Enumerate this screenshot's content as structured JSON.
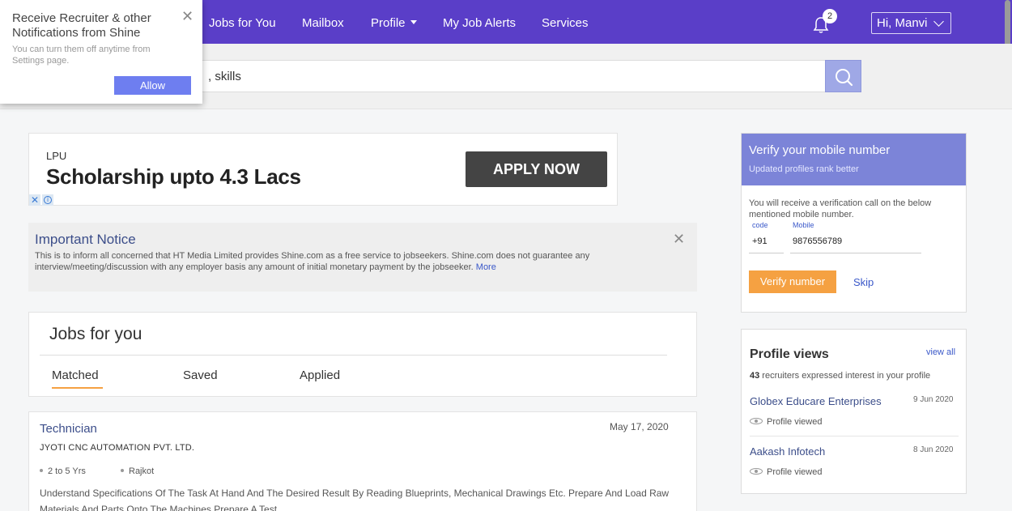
{
  "nav": {
    "items": [
      "Jobs for You",
      "Mailbox",
      "Profile",
      "My Job Alerts",
      "Services"
    ],
    "notification_count": "2",
    "user_greeting": "Hi,  Manvi"
  },
  "search": {
    "value": ", skills"
  },
  "popup": {
    "title": "Receive Recruiter & other Notifications from Shine",
    "body": "You can turn them off anytime from Settings page.",
    "allow_label": "Allow"
  },
  "ad": {
    "small": "LPU",
    "headline": "Scholarship upto 4.3 Lacs",
    "button_label": "APPLY NOW"
  },
  "notice": {
    "title": "Important Notice",
    "body": "This is to inform all concerned that HT Media Limited provides Shine.com as a free service to jobseekers. Shine.com does not guarantee any interview/meeting/discussion with any employer basis any amount of initial monetary payment by the jobseeker.",
    "more_label": "More"
  },
  "jobs_section": {
    "title": "Jobs for you",
    "tabs": [
      "Matched",
      "Saved",
      "Applied"
    ],
    "active_tab": "Matched"
  },
  "job": {
    "title": "Technician",
    "date": "May 17, 2020",
    "company": "JYOTI CNC AUTOMATION PVT. LTD.",
    "experience": "2 to 5 Yrs",
    "location": "Rajkot",
    "description": "Understand Specifications Of The Task At Hand And The Desired Result By Reading Blueprints, Mechanical Drawings Etc. Prepare And Load Raw Materials And Parts Onto The Machines Prepare A Test"
  },
  "verify": {
    "title": "Verify your mobile number",
    "subtitle": "Updated profiles rank better",
    "text": "You will receive a verification call on the below mentioned mobile number.",
    "code_label": "code",
    "code_value": "+91",
    "mobile_label": "Mobile",
    "mobile_value": "9876556789",
    "verify_label": "Verify number",
    "skip_label": "Skip"
  },
  "profile_views": {
    "title": "Profile views",
    "view_all": "view all",
    "count": "43",
    "subtitle_rest": " recruiters expressed interest in your profile",
    "entries": [
      {
        "company": "Globex Educare Enterprises",
        "date": "9 Jun 2020",
        "status": "Profile viewed"
      },
      {
        "company": "Aakash Infotech",
        "date": "8 Jun 2020",
        "status": "Profile viewed"
      }
    ]
  },
  "colors": {
    "nav_bg": "#5a3ec8",
    "accent_orange": "#f5a142",
    "link_blue": "#3a58c9",
    "verify_head": "#7c84d8"
  }
}
